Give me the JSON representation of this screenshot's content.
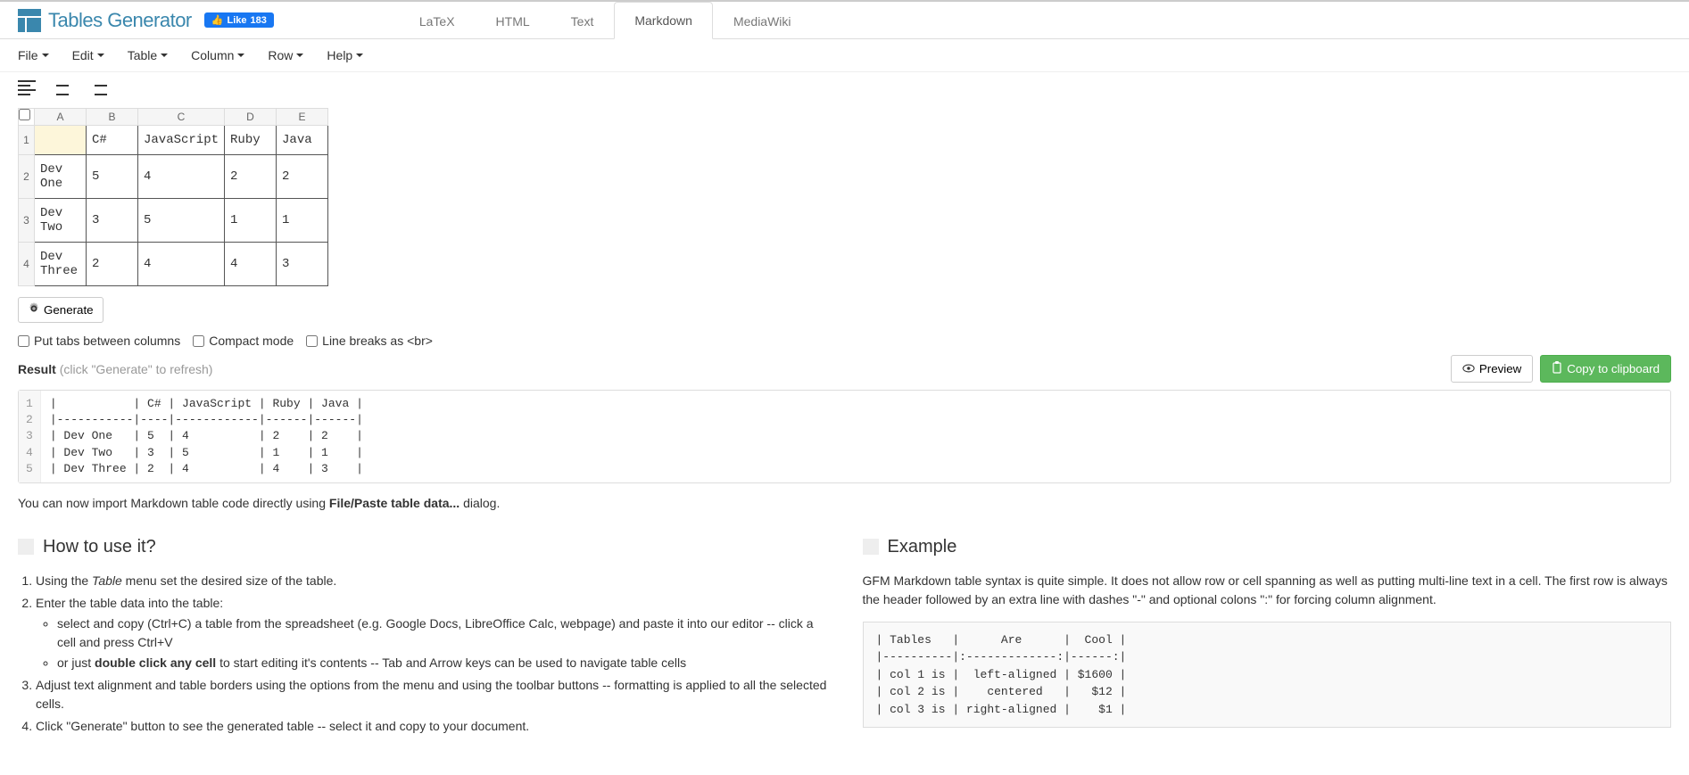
{
  "app": {
    "title": "Tables Generator",
    "like_label": "Like",
    "like_count": "183"
  },
  "top_tabs": [
    "LaTeX",
    "HTML",
    "Text",
    "Markdown",
    "MediaWiki"
  ],
  "active_top_tab": "Markdown",
  "menu": [
    "File",
    "Edit",
    "Table",
    "Column",
    "Row",
    "Help"
  ],
  "grid": {
    "cols": [
      "A",
      "B",
      "C",
      "D",
      "E"
    ],
    "rows": [
      [
        "",
        "C#",
        "JavaScript",
        "Ruby",
        "Java"
      ],
      [
        "Dev One",
        "5",
        "4",
        "2",
        "2"
      ],
      [
        "Dev Two",
        "3",
        "5",
        "1",
        "1"
      ],
      [
        "Dev Three",
        "2",
        "4",
        "4",
        "3"
      ]
    ]
  },
  "generate_label": "Generate",
  "options": {
    "tabs": "Put tabs between columns",
    "compact": "Compact mode",
    "br": "Line breaks as <br>"
  },
  "result": {
    "label": "Result",
    "hint": "(click \"Generate\" to refresh)"
  },
  "buttons": {
    "preview": "Preview",
    "copy": "Copy to clipboard"
  },
  "code_lines": [
    "|           | C# | JavaScript | Ruby | Java |",
    "|-----------|----|------------|------|------|",
    "| Dev One   | 5  | 4          | 2    | 2    |",
    "| Dev Two   | 3  | 5          | 1    | 1    |",
    "| Dev Three | 2  | 4          | 4    | 3    |"
  ],
  "import_note": {
    "pre": "You can now import Markdown table code directly using ",
    "bold": "File/Paste table data...",
    "post": " dialog."
  },
  "howto": {
    "title": "How to use it?",
    "i1_a": "Using the ",
    "i1_em": "Table",
    "i1_b": " menu set the desired size of the table.",
    "i2": "Enter the table data into the table:",
    "i2a": "select and copy (Ctrl+C) a table from the spreadsheet (e.g. Google Docs, LibreOffice Calc, webpage) and paste it into our editor -- click a cell and press Ctrl+V",
    "i2b_a": "or just ",
    "i2b_bold": "double click any cell",
    "i2b_b": " to start editing it's contents -- Tab and Arrow keys can be used to navigate table cells",
    "i3": "Adjust text alignment and table borders using the options from the menu and using the toolbar buttons -- formatting is applied to all the selected cells.",
    "i4": "Click \"Generate\" button to see the generated table -- select it and copy to your document."
  },
  "example": {
    "title": "Example",
    "desc": "GFM Markdown table syntax is quite simple. It does not allow row or cell spanning as well as putting multi-line text in a cell. The first row is always the header followed by an extra line with dashes \"-\" and optional colons \":\" for forcing column alignment.",
    "code": "| Tables   |      Are      |  Cool |\n|----------|:-------------:|------:|\n| col 1 is |  left-aligned | $1600 |\n| col 2 is |    centered   |   $12 |\n| col 3 is | right-aligned |    $1 |"
  }
}
